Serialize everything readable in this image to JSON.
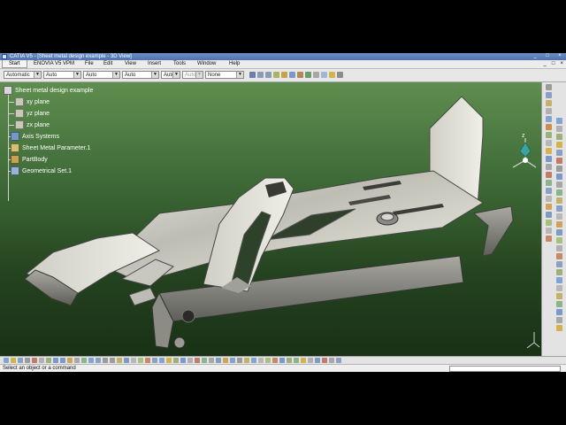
{
  "window": {
    "title": "CATIA V5 - [Sheet metal design example - 3D View]",
    "controls": [
      "_",
      "□",
      "×"
    ]
  },
  "menu": {
    "start": "Start",
    "items": [
      "ENOVIA V5 VPM",
      "File",
      "Edit",
      "View",
      "Insert",
      "Tools",
      "Window",
      "Help"
    ],
    "doc_controls": [
      "_",
      "□",
      "×"
    ]
  },
  "toolbar": {
    "dropdowns": [
      "Automatic",
      "Auto",
      "Auto",
      "Auto",
      "Auto",
      "Auto",
      "None"
    ]
  },
  "tree": {
    "root": "Sheet metal design example",
    "items": [
      "xy plane",
      "yz plane",
      "zx plane",
      "Axis Systems",
      "Sheet Metal Parameter.1",
      "PartBody",
      "Geometrical Set.1"
    ]
  },
  "compass_axis": "z",
  "status": {
    "message": "Select an object or a command"
  },
  "colors": {
    "title_bar": "#5b80bb",
    "viewport_top": "#5f8e4f",
    "viewport_bottom": "#193116",
    "part_metal": "#c2c2bc",
    "tree_text": "#ffffff"
  }
}
